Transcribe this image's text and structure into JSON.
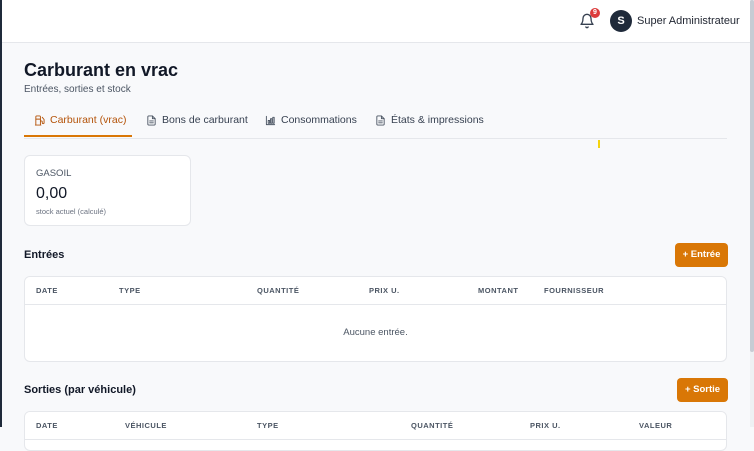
{
  "header": {
    "notifications_count": "9",
    "user_initial": "S",
    "user_name": "Super Administrateur"
  },
  "page": {
    "title": "Carburant en vrac",
    "subtitle": "Entrées, sorties et stock"
  },
  "tabs": [
    {
      "label": "Carburant (vrac)",
      "icon": "fuel-icon",
      "active": true
    },
    {
      "label": "Bons de carburant",
      "icon": "document-icon",
      "active": false
    },
    {
      "label": "Consommations",
      "icon": "bar-chart-icon",
      "active": false
    },
    {
      "label": "États & impressions",
      "icon": "document-icon",
      "active": false
    }
  ],
  "stock_card": {
    "label": "GASOIL",
    "value": "0,00",
    "note": "stock actuel (calculé)"
  },
  "entries": {
    "title": "Entrées",
    "add_button": "+ Entrée",
    "columns": [
      "DATE",
      "TYPE",
      "QUANTITÉ",
      "PRIX U.",
      "MONTANT",
      "FOURNISSEUR"
    ],
    "empty_text": "Aucune entrée."
  },
  "exits": {
    "title": "Sorties (par véhicule)",
    "add_button": "+ Sortie",
    "columns": [
      "DATE",
      "VÉHICULE",
      "TYPE",
      "QUANTITÉ",
      "PRIX U.",
      "VALEUR"
    ]
  },
  "colors": {
    "accent": "#d97706",
    "badge": "#dc3b3b",
    "avatar_bg": "#1f2a3a"
  }
}
